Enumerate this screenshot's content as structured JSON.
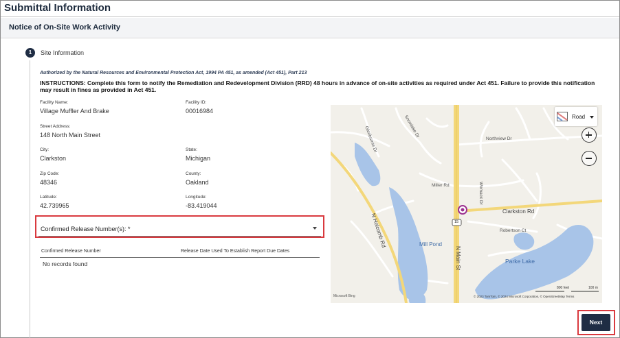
{
  "page": {
    "title": "Submittal Information",
    "section_title": "Notice of On-Site Work Activity"
  },
  "step": {
    "number": "1",
    "label": "Site Information"
  },
  "authority": "Authorized by the Natural Resources and Environmental Protection Act, 1994 PA 451, as amended (Act 451), Part 213",
  "instructions": "INSTRUCTIONS: Complete this form to notify the Remediation and Redevelopment Division (RRD) 48 hours in advance of on-site activities as required under Act 451. Failure to provide this notification may result in fines as provided in Act 451.",
  "fields": {
    "facility_name": {
      "label": "Facility Name:",
      "value": "Village Muffler And Brake"
    },
    "facility_id": {
      "label": "Facility ID:",
      "value": "00016984"
    },
    "street": {
      "label": "Street Address:",
      "value": "148 North Main Street"
    },
    "city": {
      "label": "City:",
      "value": "Clarkston"
    },
    "state": {
      "label": "State:",
      "value": "Michigan"
    },
    "zip": {
      "label": "Zip Code:",
      "value": "48346"
    },
    "county": {
      "label": "County:",
      "value": "Oakland"
    },
    "latitude": {
      "label": "Latitude:",
      "value": "42.739965"
    },
    "longitude": {
      "label": "Longitude:",
      "value": "-83.419044"
    }
  },
  "release_select": {
    "label": "Confirmed Release Number(s): *"
  },
  "release_table": {
    "columns": [
      "Confirmed Release Number",
      "Release Date Used To Establish Report Due Dates"
    ],
    "empty_text": "No records found"
  },
  "map": {
    "style_label": "Road",
    "labels": {
      "glenburnie": "Glenburnie Dr",
      "snowlake": "Snowlake Dr",
      "northview": "Northview Dr",
      "miller": "Miller Rd",
      "clarkston_rd": "Clarkston Rd",
      "robertson": "Robertson Ct",
      "womack": "Womack Dr",
      "n_holcomb": "N Holcomb Rd",
      "n_main": "N Main St",
      "mill_pond": "Mill Pond",
      "parke_lake": "Parke Lake",
      "route": "15"
    },
    "scale": {
      "feet": "800 feet",
      "meters": "100 m"
    },
    "attribution": "© 2023 TomTom, © 2024 Microsoft Corporation, © OpenStreetMap   Terms",
    "logo": "Microsoft Bing",
    "colors": {
      "water": "#a8c4e8",
      "highway": "#f3d77a",
      "pin": "#9b2f8f"
    }
  },
  "next_button": {
    "label": "Next"
  }
}
